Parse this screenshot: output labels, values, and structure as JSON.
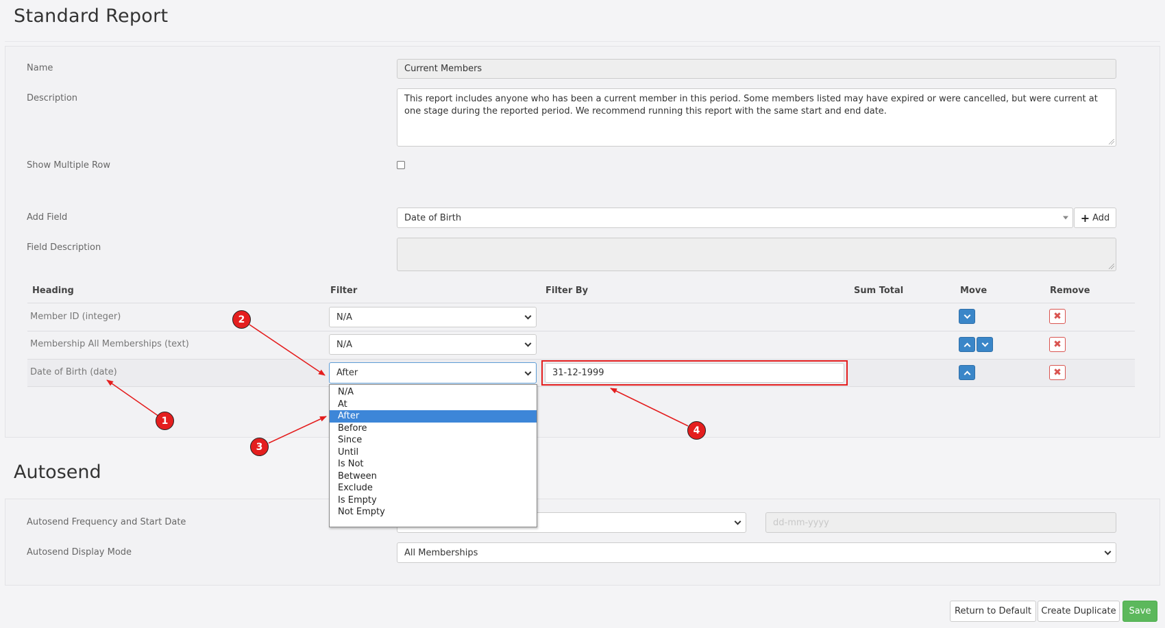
{
  "page_title": "Standard Report",
  "form": {
    "name_label": "Name",
    "name_value": "Current Members",
    "description_label": "Description",
    "description_value": "This report includes anyone who has been a current member in this period. Some members listed may have expired or were cancelled, but were current at one stage during the reported period. We recommend running this report with the same start and end date.",
    "show_multiple_row_label": "Show Multiple Row",
    "add_field_label": "Add Field",
    "add_field_value": "Date of Birth",
    "add_button_label": "Add",
    "field_description_label": "Field Description",
    "field_description_value": ""
  },
  "table": {
    "headers": {
      "heading": "Heading",
      "filter": "Filter",
      "filter_by": "Filter By",
      "sum_total": "Sum Total",
      "move": "Move",
      "remove": "Remove"
    },
    "rows": [
      {
        "heading": "Member ID (integer)",
        "filter": "N/A",
        "filter_by": ""
      },
      {
        "heading": "Membership All Memberships (text)",
        "filter": "N/A",
        "filter_by": ""
      },
      {
        "heading": "Date of Birth (date)",
        "filter": "After",
        "filter_by": "31-12-1999"
      }
    ]
  },
  "filter_dropdown": {
    "selected": "After",
    "options": [
      "N/A",
      "At",
      "After",
      "Before",
      "Since",
      "Until",
      "Is Not",
      "Between",
      "Exclude",
      "Is Empty",
      "Not Empty"
    ]
  },
  "annotations": [
    "1",
    "2",
    "3",
    "4"
  ],
  "autosend": {
    "title": "Autosend",
    "frequency_label": "Autosend Frequency and Start Date",
    "frequency_value": "",
    "start_date_placeholder": "dd-mm-yyyy",
    "display_mode_label": "Autosend Display Mode",
    "display_mode_value": "All Memberships"
  },
  "footer": {
    "return_default_label": "Return to Default",
    "create_duplicate_label": "Create Duplicate",
    "save_label": "Save"
  },
  "colors": {
    "accent_blue": "#3a86c8",
    "danger_red": "#d9534f",
    "save_green": "#5cb85c",
    "annotation_red": "#e41e1e"
  }
}
